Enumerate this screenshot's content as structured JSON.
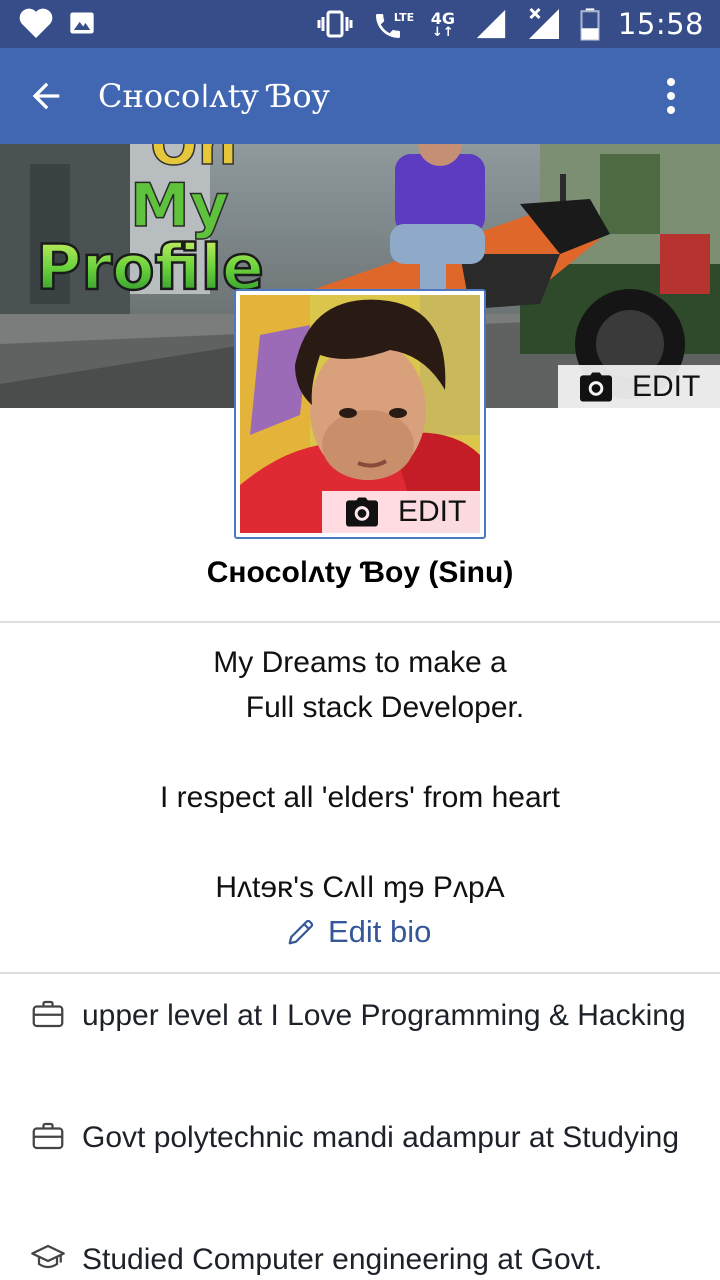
{
  "status_bar": {
    "time": "15:58",
    "network_type": "4G",
    "lte_label": "LTE"
  },
  "app_bar": {
    "title": "Cʜocoǀʌty Ɓoy"
  },
  "cover": {
    "edit_label": "EDIT",
    "overlay_text": [
      "On",
      "My",
      "Profile"
    ]
  },
  "avatar": {
    "edit_label": "EDIT"
  },
  "profile": {
    "name": "Cʜocoǀʌty Ɓoy (Sinu)"
  },
  "bio": {
    "lines": [
      "My Dreams to make a",
      "  Full stack Developer.",
      "",
      "I respect all 'elders' from heart",
      "",
      "Hʌtɘʀ's Cʌǀǀ ɱɘ PʌpA"
    ],
    "edit_label": "Edit bio"
  },
  "intro": {
    "items": [
      {
        "icon": "briefcase-icon",
        "text": "upper level at I Love Programming & Hacking"
      },
      {
        "icon": "briefcase-icon",
        "text": "Govt polytechnic mandi adampur at Studying"
      },
      {
        "icon": "graduation-cap-icon",
        "text": "Studied Computer engineering at Govt."
      }
    ]
  },
  "colors": {
    "app_bar": "#4267b2",
    "status_bar": "#364d8a",
    "link": "#365899",
    "divider": "#dddfe2"
  }
}
